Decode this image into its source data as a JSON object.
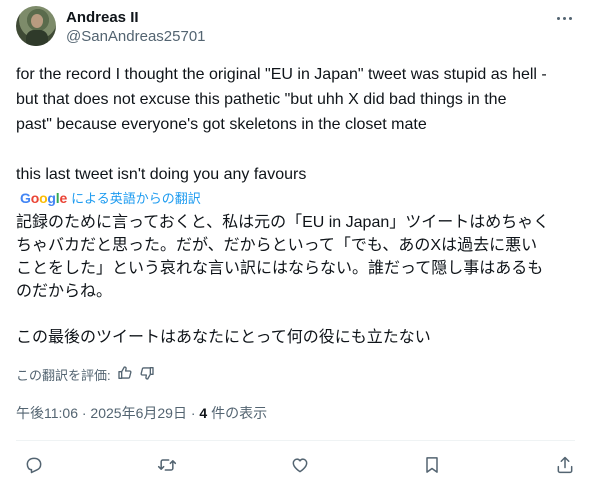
{
  "author": {
    "display_name": "Andreas II",
    "handle": "@SanAndreas25701",
    "avatar": "avatar-photo"
  },
  "menu_icon": "more-horizontal-icon",
  "tweet": {
    "text": "for the record I thought the original \"EU in Japan\" tweet was stupid as hell -\nbut that does not excuse this pathetic \"but uhh X did bad things in the\npast\" because everyone's got skeletons in the closet mate\n\nthis last tweet isn't doing you any favours"
  },
  "translation": {
    "google_logo": "Google",
    "link_text": "による英語からの翻訳",
    "text": "記録のために言っておくと、私は元の「EU in Japan」ツイートはめちゃく\nちゃバカだと思った。だが、だからといって「でも、あのXは過去に悪い\nことをした」という哀れな言い訳にはならない。誰だって隠し事はあるも\nのだからね。\n\nこの最後のツイートはあなたにとって何の役にも立たない",
    "rate_label": "この翻訳を評価:",
    "rate_icons": [
      "thumbs-up-icon",
      "thumbs-down-icon"
    ]
  },
  "meta": {
    "time_date": "午後11:06 · 2025年6月29日 · ",
    "views_count": "4",
    "views_label": " 件の表示"
  },
  "actions": [
    "reply-icon",
    "retweet-icon",
    "like-icon",
    "bookmark-icon",
    "share-icon"
  ]
}
